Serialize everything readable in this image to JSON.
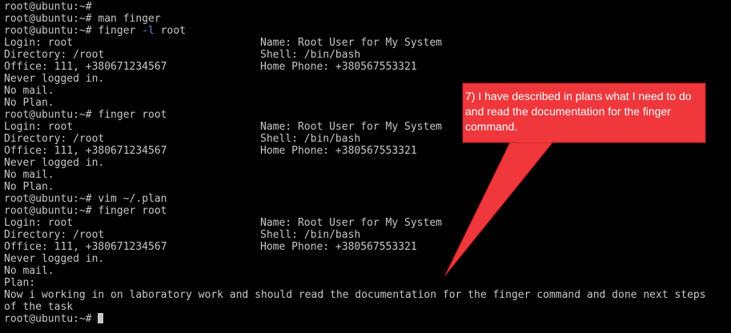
{
  "terminal": {
    "prompt": "root@ubuntu:~#",
    "cmd_man": "man finger",
    "cmd_finger_l_pre": "finger ",
    "cmd_finger_l_flag": "-l",
    "cmd_finger_l_post": " root",
    "cmd_finger": "finger root",
    "cmd_vim": "vim ~/.plan",
    "login": "Login: root",
    "name": "Name: Root User for My System",
    "directory": "Directory: /root",
    "shell": "Shell: /bin/bash",
    "office": "Office: 111, +380671234567",
    "home_phone": "Home Phone: +380567553321",
    "never_logged": "Never logged in.",
    "no_mail": "No mail.",
    "no_plan": "No Plan.",
    "plan_label": "Plan:",
    "plan_text_1": "Now i working in on laboratory work and should read the documentation for the finger command and done next steps",
    "plan_text_2": "of the task"
  },
  "annotation": {
    "text": "7) I have described in plans what I need to do and read the documentation for the finger command.",
    "color": "#f0373b",
    "border_color": "#c01f24",
    "text_color": "#ffffff"
  },
  "colors": {
    "background": "#000000",
    "foreground": "#c7c7c7",
    "flag": "#5b8bd6"
  }
}
